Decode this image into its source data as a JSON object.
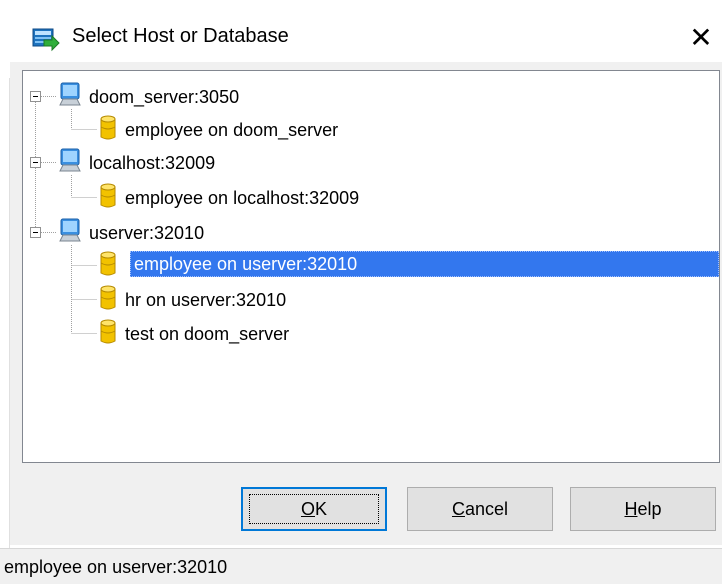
{
  "window": {
    "title": "Select Host or Database",
    "close_glyph": "✕"
  },
  "tree": {
    "hosts": [
      {
        "label": "doom_server:3050",
        "icon": "computer-icon",
        "expanded": true,
        "databases": [
          {
            "label": "employee on doom_server",
            "icon": "database-icon",
            "selected": false
          }
        ]
      },
      {
        "label": "localhost:32009",
        "icon": "computer-icon",
        "expanded": true,
        "databases": [
          {
            "label": "employee on localhost:32009",
            "icon": "database-icon",
            "selected": false
          }
        ]
      },
      {
        "label": "userver:32010",
        "icon": "computer-icon",
        "expanded": true,
        "databases": [
          {
            "label": "employee on userver:32010",
            "icon": "database-icon",
            "selected": true
          },
          {
            "label": "hr on userver:32010",
            "icon": "database-icon",
            "selected": false
          },
          {
            "label": "test on doom_server",
            "icon": "database-icon",
            "selected": false
          }
        ]
      }
    ]
  },
  "buttons": {
    "ok": {
      "mnemonic": "O",
      "rest": "K"
    },
    "cancel": {
      "mnemonic": "C",
      "rest": "ancel"
    },
    "help": {
      "mnemonic": "H",
      "rest": "elp"
    }
  },
  "status": {
    "text": "employee on userver:32010"
  },
  "colors": {
    "selection": "#3377ee",
    "default_button_border": "#0078d7",
    "button_face": "#e1e1e1"
  }
}
